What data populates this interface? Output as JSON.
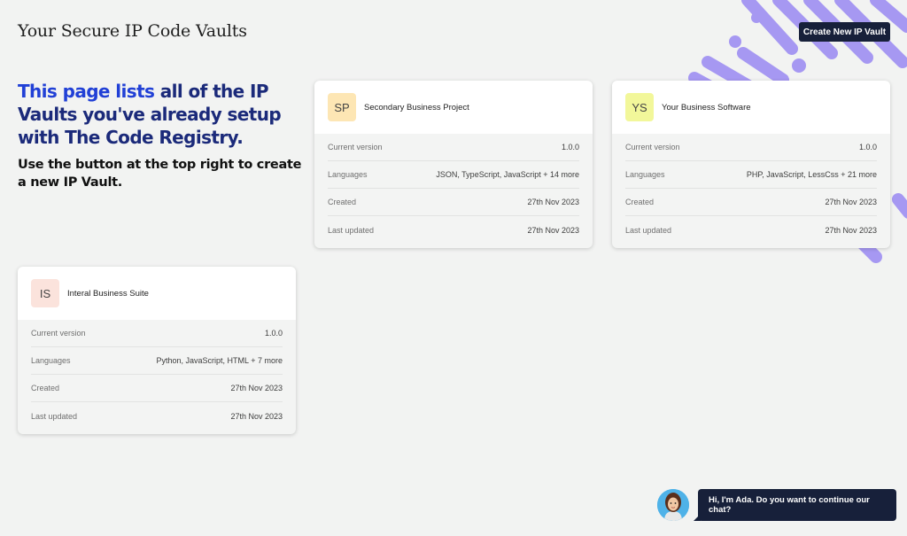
{
  "header": {
    "title": "Your Secure IP Code Vaults",
    "create_button": "Create New IP Vault"
  },
  "intro": {
    "headline_part1": "This page lists",
    "headline_part2": " all of the IP Vaults you've already setup with The Code Registry.",
    "subtext": "Use the button at the top right to create a new IP Vault."
  },
  "labels": {
    "current_version": "Current version",
    "languages": "Languages",
    "created": "Created",
    "last_updated": "Last updated"
  },
  "vaults": [
    {
      "initials": "SP",
      "name": "Secondary Business Project",
      "color": "#fde6b4",
      "current_version": "1.0.0",
      "languages": "JSON, TypeScript, JavaScript + 14 more",
      "created": "27th Nov 2023",
      "last_updated": "27th Nov 2023"
    },
    {
      "initials": "YS",
      "name": "Your Business Software",
      "color": "#f2f79a",
      "current_version": "1.0.0",
      "languages": "PHP, JavaScript, LessCss + 21 more",
      "created": "27th Nov 2023",
      "last_updated": "27th Nov 2023"
    },
    {
      "initials": "IS",
      "name": "Interal Business Suite",
      "color": "#fbe3dc",
      "current_version": "1.0.0",
      "languages": "Python, JavaScript, HTML + 7 more",
      "created": "27th Nov 2023",
      "last_updated": "27th Nov 2023"
    }
  ],
  "chat": {
    "message": "Hi, I'm Ada. Do you want to continue our chat?"
  },
  "colors": {
    "accent": "#9b8df0",
    "navy": "#17203a",
    "headline_blue": "#2140d6"
  }
}
